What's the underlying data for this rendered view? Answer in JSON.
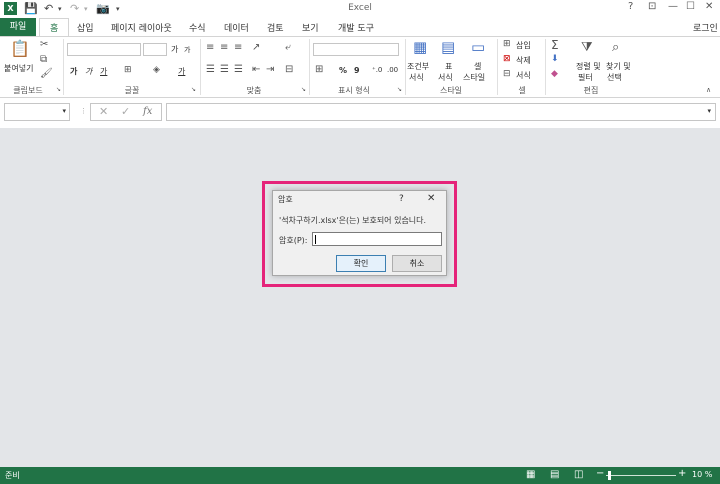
{
  "titlebar": {
    "app_title": "Excel",
    "win_help": "?",
    "win_ribbon": "⊡",
    "win_min": "—",
    "win_max": "☐",
    "win_close": "✕"
  },
  "tabs": {
    "file": "파일",
    "home": "홈",
    "insert": "삽입",
    "page_layout": "페이지 레이아웃",
    "formulas": "수식",
    "data": "데이터",
    "review": "검토",
    "view": "보기",
    "developer": "개발 도구",
    "signin": "로그인"
  },
  "ribbon": {
    "clipboard": {
      "paste": "붙여넣기",
      "label": "클립보드"
    },
    "font": {
      "bold": "가",
      "italic": "가",
      "underline": "가",
      "label": "글꼴",
      "grow": "가",
      "shrink": "가",
      "font_color": "가"
    },
    "alignment": {
      "label": "맞춤"
    },
    "number": {
      "percent": "%",
      "comma": "9",
      "inc_dec": "⁺.0",
      "dec_dec": ".00",
      "label": "표시 형식"
    },
    "styles": {
      "conditional_1": "조건부",
      "conditional_2": "서식",
      "table_1": "표",
      "table_2": "서식",
      "cell_1": "셀",
      "cell_2": "스타일",
      "label": "스타일"
    },
    "cells": {
      "insert": "삽입",
      "delete": "삭제",
      "format": "서식",
      "label": "셀"
    },
    "editing": {
      "sort_1": "정렬 및",
      "sort_2": "필터",
      "find_1": "찾기 및",
      "find_2": "선택",
      "label": "편집"
    }
  },
  "formula_bar": {
    "cancel": "✕",
    "confirm": "✓",
    "fx": "fx"
  },
  "dialog": {
    "title": "암호",
    "help": "?",
    "close": "✕",
    "message": "'석차구하기.xlsx'은(는) 보호되어 있습니다.",
    "password_label": "암호(P):",
    "password_value": "",
    "ok": "확인",
    "cancel": "취소"
  },
  "statusbar": {
    "ready": "준비",
    "zoom_minus": "−",
    "zoom_plus": "+",
    "zoom": "10 %"
  },
  "colors": {
    "excel_green": "#217346",
    "highlight": "#e5247a",
    "dialog_bg": "#f0f0f0"
  }
}
